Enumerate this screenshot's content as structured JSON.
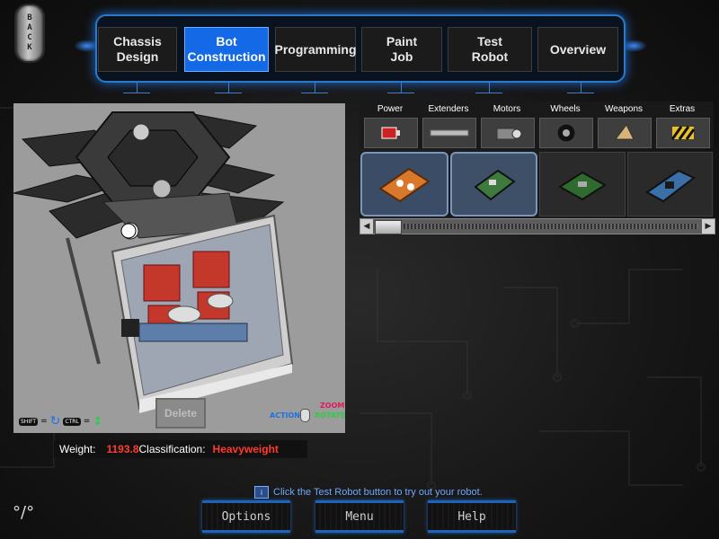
{
  "back_button": {
    "label": "BACK"
  },
  "nav": {
    "tabs": [
      {
        "label": "Chassis\nDesign",
        "active": false
      },
      {
        "label": "Bot\nConstruction",
        "active": true
      },
      {
        "label": "Programming",
        "active": false
      },
      {
        "label": "Paint\nJob",
        "active": false
      },
      {
        "label": "Test\nRobot",
        "active": false
      },
      {
        "label": "Overview",
        "active": false
      }
    ]
  },
  "viewport": {
    "delete_label": "Delete",
    "shift_key": "SHIFT",
    "ctrl_key": "CTRL",
    "zoom_label": "ZOOM",
    "action_label": "ACTION",
    "rotate_label": "ROTATE",
    "equals": "="
  },
  "stats": {
    "weight_label": "Weight:",
    "weight_value": "1193.8",
    "class_label": "Classification:",
    "class_value": "Heavyweight"
  },
  "parts": {
    "categories": [
      {
        "label": "Power",
        "icon": "battery-icon"
      },
      {
        "label": "Extenders",
        "icon": "extender-bar-icon"
      },
      {
        "label": "Motors",
        "icon": "motor-icon"
      },
      {
        "label": "Wheels",
        "icon": "wheel-icon"
      },
      {
        "label": "Weapons",
        "icon": "weapon-icon"
      },
      {
        "label": "Extras",
        "icon": "extras-icon"
      }
    ],
    "items": [
      {
        "name": "orange-battery-pack",
        "color": "#d9772b"
      },
      {
        "name": "green-circuit-board",
        "color": "#3e7a3e"
      },
      {
        "name": "green-controller-board",
        "color": "#2f6b2f"
      },
      {
        "name": "blue-battery-cell",
        "color": "#3a6fa8"
      }
    ]
  },
  "footer": {
    "hint": "Click the Test Robot button to try out your robot.",
    "hint_icon": "i",
    "options_label": "Options",
    "menu_label": "Menu",
    "help_label": "Help"
  },
  "colors": {
    "accent": "#1469e6",
    "stat_value": "#ff3b2f",
    "hint_text": "#6fa8ff"
  }
}
